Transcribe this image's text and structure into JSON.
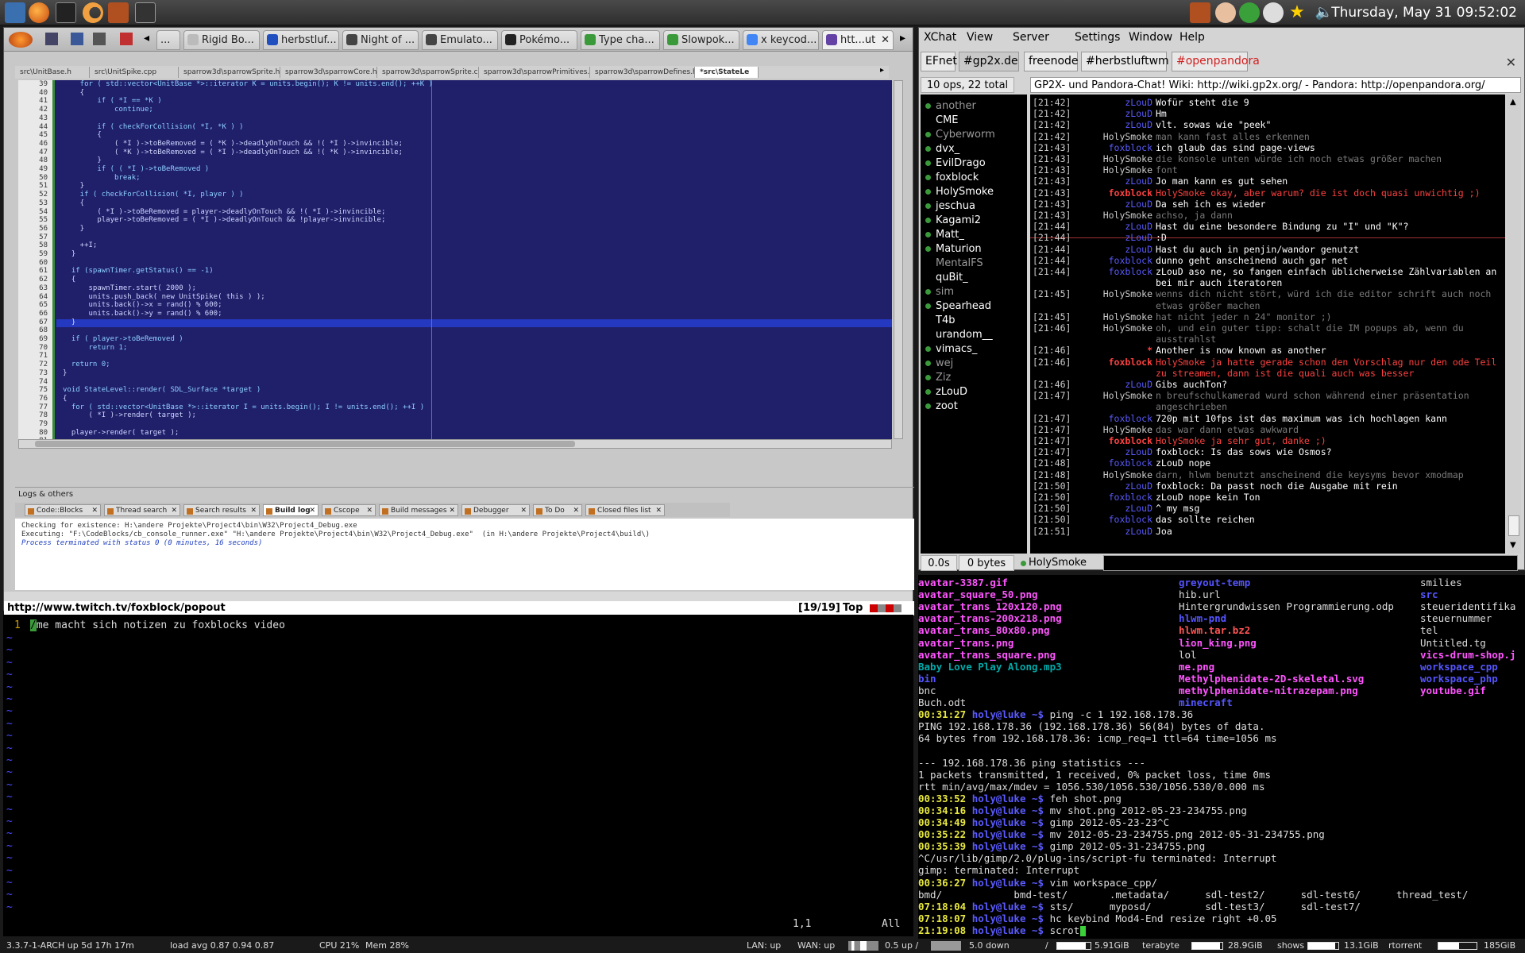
{
  "topbar": {
    "clock": "Thursday, May 31 09:52:02"
  },
  "firefox": {
    "tabs": [
      "...",
      "Rigid Bo...",
      "herbstluf...",
      "Night of ...",
      "Emulato...",
      "Pokémo...",
      "Type cha...",
      "Slowpok...",
      "x keycod...",
      "htt...ut"
    ],
    "status_url": "http://www.twitch.tv/foxblock/popout",
    "vim_pos": "[19/19]",
    "vim_top": "Top"
  },
  "codeblocks": {
    "file_tabs": [
      "src\\UnitBase.h",
      "src\\UnitSpike.cpp",
      "sparrow3d\\sparrowSprite.h",
      "sparrow3d\\sparrowCore.h",
      "sparrow3d\\sparrowSprite.c",
      "sparrow3d\\sparrowPrimitives.c",
      "sparrow3d\\sparrowDefines.h",
      "*src\\StateLe"
    ],
    "line_numbers": [
      "39",
      "40",
      "41",
      "42",
      "43",
      "44",
      "45",
      "46",
      "47",
      "48",
      "49",
      "50",
      "51",
      "52",
      "53",
      "54",
      "55",
      "56",
      "57",
      "58",
      "59",
      "60",
      "61",
      "62",
      "63",
      "64",
      "65",
      "66",
      "67",
      "68",
      "69",
      "70",
      "71",
      "72",
      "73",
      "74",
      "75",
      "76",
      "77",
      "78",
      "79",
      "80",
      "81"
    ],
    "code_lines": [
      "    for ( std::vector<UnitBase *>::iterator K = units.begin(); K != units.end(); ++K )",
      "    {",
      "        if ( *I == *K )",
      "            continue;",
      "",
      "        if ( checkForCollision( *I, *K ) )",
      "        {",
      "            ( *I )->toBeRemoved = ( *K )->deadlyOnTouch && !( *I )->invincible;",
      "            ( *K )->toBeRemoved = ( *I )->deadlyOnTouch && !( *K )->invincible;",
      "        }",
      "        if ( ( *I )->toBeRemoved )",
      "            break;",
      "    }",
      "    if ( checkForCollision( *I, player ) )",
      "    {",
      "        ( *I )->toBeRemoved = player->deadlyOnTouch && !( *I )->invincible;",
      "        player->toBeRemoved = ( *I )->deadlyOnTouch && !player->invincible;",
      "    }",
      "",
      "    ++I;",
      "  }",
      "",
      "  if (spawnTimer.getStatus() == -1)",
      "  {",
      "      spawnTimer.start( 2000 );",
      "      units.push_back( new UnitSpike( this ) );",
      "      units.back()->x = rand() % 600;",
      "      units.back()->y = rand() % 600;",
      "  }",
      "",
      "  if ( player->toBeRemoved )",
      "      return 1;",
      "",
      "  return 0;",
      "}",
      "",
      "void StateLevel::render( SDL_Surface *target )",
      "{",
      "  for ( std::vector<UnitBase *>::iterator I = units.begin(); I != units.end(); ++I )",
      "      ( *I )->render( target );",
      "",
      "  player->render( target );",
      ""
    ],
    "logs_title": "Logs & others",
    "log_tabs": [
      "Code::Blocks",
      "Thread search",
      "Search results",
      "Build log",
      "Cscope",
      "Build messages",
      "Debugger",
      "To Do",
      "Closed files list"
    ],
    "log_lines": [
      "Checking for existence: H:\\andere Projekte\\Project4\\bin\\W32\\Project4_Debug.exe",
      "Executing: \"F:\\CodeBlocks/cb_console_runner.exe\" \"H:\\andere Projekte\\Project4\\bin\\W32\\Project4_Debug.exe\"  (in H:\\andere Projekte\\Project4\\build\\)",
      "Process terminated with status 0 (0 minutes, 16 seconds)"
    ]
  },
  "vim": {
    "line_number": "1",
    "line_text": "/me macht sich notizen zu foxblocks video",
    "ruler": "1,1",
    "position": "All"
  },
  "xchat": {
    "menu": [
      "XChat",
      "View",
      "Server",
      "Settings",
      "Window",
      "Help"
    ],
    "networks": [
      "EFnet",
      "#gp2x.de",
      "freenode",
      "#herbstluftwm",
      "#openpandora"
    ],
    "ops_summary": "10 ops, 22 total",
    "topic": "GP2X- und Pandora-Chat! Wiki: http://wiki.gp2x.org/ - Pandora: http://openpandora.org/",
    "users": [
      {
        "nick": "another",
        "color": "#9a9a9a",
        "dot": "#3a9a3a"
      },
      {
        "nick": "CME",
        "color": "#ffffff",
        "dot": ""
      },
      {
        "nick": "Cyberworm",
        "color": "#9a9a9a",
        "dot": "#3a9a3a"
      },
      {
        "nick": "dvx_",
        "color": "#ffffff",
        "dot": "#3a9a3a"
      },
      {
        "nick": "EvilDrago",
        "color": "#ffffff",
        "dot": "#3a9a3a"
      },
      {
        "nick": "foxblock",
        "color": "#ffffff",
        "dot": "#3a9a3a"
      },
      {
        "nick": "HolySmoke",
        "color": "#ffffff",
        "dot": "#3a9a3a"
      },
      {
        "nick": "jeschua",
        "color": "#ffffff",
        "dot": "#3a9a3a"
      },
      {
        "nick": "Kagami2",
        "color": "#ffffff",
        "dot": "#3a9a3a"
      },
      {
        "nick": "Matt_",
        "color": "#ffffff",
        "dot": "#3a9a3a"
      },
      {
        "nick": "Maturion",
        "color": "#ffffff",
        "dot": "#3a9a3a"
      },
      {
        "nick": "MentalFS",
        "color": "#9a9a9a",
        "dot": ""
      },
      {
        "nick": "quBit_",
        "color": "#ffffff",
        "dot": ""
      },
      {
        "nick": "sim",
        "color": "#9a9a9a",
        "dot": "#3a9a3a"
      },
      {
        "nick": "Spearhead",
        "color": "#ffffff",
        "dot": "#3a9a3a"
      },
      {
        "nick": "T4b",
        "color": "#ffffff",
        "dot": ""
      },
      {
        "nick": "urandom__",
        "color": "#ffffff",
        "dot": ""
      },
      {
        "nick": "vimacs_",
        "color": "#ffffff",
        "dot": "#3a9a3a"
      },
      {
        "nick": "wej",
        "color": "#9a9a9a",
        "dot": "#3a9a3a"
      },
      {
        "nick": "Ziz",
        "color": "#9a9a9a",
        "dot": "#3a9a3a"
      },
      {
        "nick": "zLouD",
        "color": "#ffffff",
        "dot": "#3a9a3a"
      },
      {
        "nick": "zoot",
        "color": "#ffffff",
        "dot": "#3a9a3a"
      }
    ],
    "messages": [
      {
        "t": "[21:42]",
        "n": "zLouD",
        "nc": "#5a5aff",
        "m": "Wofür steht die 9",
        "mc": "#ffffff"
      },
      {
        "t": "[21:42]",
        "n": "zLouD",
        "nc": "#5a5aff",
        "m": "Hm",
        "mc": "#ffffff"
      },
      {
        "t": "[21:42]",
        "n": "zLouD",
        "nc": "#5a5aff",
        "m": "vlt. sowas wie \"peek\"",
        "mc": "#ffffff"
      },
      {
        "t": "[21:42]",
        "n": "HolySmoke",
        "nc": "#cccccc",
        "m": "man kann fast alles erkennen",
        "mc": "#7a7a7a"
      },
      {
        "t": "[21:43]",
        "n": "foxblock",
        "nc": "#5a5aff",
        "m": "ich glaub das sind page-views",
        "mc": "#ffffff"
      },
      {
        "t": "[21:43]",
        "n": "HolySmoke",
        "nc": "#cccccc",
        "m": "die konsole unten würde ich noch etwas größer machen",
        "mc": "#7a7a7a"
      },
      {
        "t": "[21:43]",
        "n": "HolySmoke",
        "nc": "#cccccc",
        "m": "font",
        "mc": "#7a7a7a"
      },
      {
        "t": "[21:43]",
        "n": "zLouD",
        "nc": "#5a5aff",
        "m": "Jo man kann es gut sehen",
        "mc": "#ffffff"
      },
      {
        "t": "[21:43]",
        "n": "foxblock",
        "nc": "#ff4040",
        "m": "HolySmoke okay, aber warum? die ist doch quasi unwichtig ;)",
        "mc": "#ff4040"
      },
      {
        "t": "[21:43]",
        "n": "zLouD",
        "nc": "#5a5aff",
        "m": "Da seh ich es wieder",
        "mc": "#ffffff"
      },
      {
        "t": "[21:43]",
        "n": "HolySmoke",
        "nc": "#cccccc",
        "m": "achso, ja dann",
        "mc": "#7a7a7a"
      },
      {
        "t": "[21:44]",
        "n": "zLouD",
        "nc": "#5a5aff",
        "m": "Hast du eine besondere Bindung zu \"I\" und \"K\"?",
        "mc": "#ffffff"
      },
      {
        "t": "[21:44]",
        "n": "zLouD",
        "nc": "#5a5aff",
        "m": ":D",
        "mc": "#ffffff"
      },
      {
        "t": "[21:44]",
        "n": "zLouD",
        "nc": "#5a5aff",
        "m": "Hast du auch in penjin/wandor genutzt",
        "mc": "#ffffff"
      },
      {
        "t": "[21:44]",
        "n": "foxblock",
        "nc": "#5a5aff",
        "m": "dunno geht anscheinend auch gar net",
        "mc": "#ffffff"
      },
      {
        "t": "[21:44]",
        "n": "foxblock",
        "nc": "#5a5aff",
        "m": "zLouD aso ne, so fangen einfach üblicherweise Zählvariablen an",
        "mc": "#ffffff"
      },
      {
        "t": "",
        "n": "",
        "nc": "#5a5aff",
        "m": "bei mir auch iteratoren",
        "mc": "#ffffff"
      },
      {
        "t": "[21:45]",
        "n": "HolySmoke",
        "nc": "#cccccc",
        "m": "wenns dich nicht stört, würd ich die editor schrift auch noch",
        "mc": "#7a7a7a"
      },
      {
        "t": "",
        "n": "",
        "nc": "#cccccc",
        "m": "etwas größer machen",
        "mc": "#7a7a7a"
      },
      {
        "t": "[21:45]",
        "n": "HolySmoke",
        "nc": "#cccccc",
        "m": "hat nicht jeder n 24\" monitor ;)",
        "mc": "#7a7a7a"
      },
      {
        "t": "[21:46]",
        "n": "HolySmoke",
        "nc": "#cccccc",
        "m": "oh, und ein guter tipp: schalt die IM popups ab, wenn du",
        "mc": "#7a7a7a"
      },
      {
        "t": "",
        "n": "",
        "nc": "#cccccc",
        "m": "ausstrahlst",
        "mc": "#7a7a7a"
      },
      {
        "t": "[21:46]",
        "n": "*",
        "nc": "#ff4040",
        "m": "Another is now known as another",
        "mc": "#ffffff"
      },
      {
        "t": "[21:46]",
        "n": "foxblock",
        "nc": "#ff4040",
        "m": "HolySmoke ja hatte gerade schon den Vorschlag nur den ode Teil",
        "mc": "#ff4040"
      },
      {
        "t": "",
        "n": "",
        "nc": "#ff4040",
        "m": "zu streamen, dann ist die quali auch was besser",
        "mc": "#ff4040"
      },
      {
        "t": "[21:46]",
        "n": "zLouD",
        "nc": "#5a5aff",
        "m": "Gibs auchTon?",
        "mc": "#ffffff"
      },
      {
        "t": "[21:47]",
        "n": "HolySmoke",
        "nc": "#cccccc",
        "m": "n breufschulkamerad wurd schon während einer präsentation",
        "mc": "#7a7a7a"
      },
      {
        "t": "",
        "n": "",
        "nc": "#cccccc",
        "m": "angeschrieben",
        "mc": "#7a7a7a"
      },
      {
        "t": "[21:47]",
        "n": "foxblock",
        "nc": "#5a5aff",
        "m": "720p mit 10fps ist das maximum was ich hochlagen kann",
        "mc": "#ffffff"
      },
      {
        "t": "[21:47]",
        "n": "HolySmoke",
        "nc": "#cccccc",
        "m": "das war dann etwas awkward",
        "mc": "#7a7a7a"
      },
      {
        "t": "[21:47]",
        "n": "foxblock",
        "nc": "#ff4040",
        "m": "HolySmoke ja sehr gut, danke ;)",
        "mc": "#ff4040"
      },
      {
        "t": "[21:47]",
        "n": "zLouD",
        "nc": "#5a5aff",
        "m": "foxblock: Is das sows wie Osmos?",
        "mc": "#ffffff"
      },
      {
        "t": "[21:48]",
        "n": "foxblock",
        "nc": "#5a5aff",
        "m": "zLouD nope",
        "mc": "#ffffff"
      },
      {
        "t": "[21:48]",
        "n": "HolySmoke",
        "nc": "#cccccc",
        "m": "darn, hlwm benutzt anscheinend die keysyms bevor xmodmap",
        "mc": "#7a7a7a"
      },
      {
        "t": "[21:50]",
        "n": "zLouD",
        "nc": "#5a5aff",
        "m": "foxblock: Da passt noch die Ausgabe mit rein",
        "mc": "#ffffff"
      },
      {
        "t": "[21:50]",
        "n": "foxblock",
        "nc": "#5a5aff",
        "m": "zLouD nope kein Ton",
        "mc": "#ffffff"
      },
      {
        "t": "[21:50]",
        "n": "zLouD",
        "nc": "#5a5aff",
        "m": "^ my msg",
        "mc": "#ffffff"
      },
      {
        "t": "[21:50]",
        "n": "foxblock",
        "nc": "#5a5aff",
        "m": "das sollte reichen",
        "mc": "#ffffff"
      },
      {
        "t": "[21:51]",
        "n": "zLouD",
        "nc": "#5a5aff",
        "m": "Joa",
        "mc": "#ffffff"
      }
    ],
    "lag": "0.0s",
    "bytes": "0 bytes",
    "my_nick": "HolySmoke"
  },
  "terminal": {
    "ls1_col1": [
      {
        "t": "avatar-3387.gif",
        "c": "#ff55ff"
      },
      {
        "t": "avatar_square_50.png",
        "c": "#ff55ff"
      },
      {
        "t": "avatar_trans_120x120.png",
        "c": "#ff55ff"
      },
      {
        "t": "avatar_trans-200x218.png",
        "c": "#ff55ff"
      },
      {
        "t": "avatar_trans_80x80.png",
        "c": "#ff55ff"
      },
      {
        "t": "avatar_trans.png",
        "c": "#ff55ff"
      },
      {
        "t": "avatar_trans_square.png",
        "c": "#ff55ff"
      },
      {
        "t": "Baby Love Play Along.mp3",
        "c": "#00aaaa"
      },
      {
        "t": "bin",
        "c": "#5555ff"
      },
      {
        "t": "bnc",
        "c": "#dddddd"
      },
      {
        "t": "Buch.odt",
        "c": "#dddddd"
      }
    ],
    "ls1_col2": [
      {
        "t": "greyout-temp",
        "c": "#5555ff"
      },
      {
        "t": "hib.url",
        "c": "#dddddd"
      },
      {
        "t": "Hintergrundwissen Programmierung.odp",
        "c": "#dddddd"
      },
      {
        "t": "hlwm-pnd",
        "c": "#5555ff"
      },
      {
        "t": "hlwm.tar.bz2",
        "c": "#ff5555"
      },
      {
        "t": "lion_king.png",
        "c": "#ff55ff"
      },
      {
        "t": "lol",
        "c": "#dddddd"
      },
      {
        "t": "me.png",
        "c": "#ff55ff"
      },
      {
        "t": "Methylphenidate-2D-skeletal.svg",
        "c": "#ff55ff"
      },
      {
        "t": "methylphenidate-nitrazepam.png",
        "c": "#ff55ff"
      },
      {
        "t": "minecraft",
        "c": "#5555ff"
      }
    ],
    "ls1_col3": [
      {
        "t": "smilies",
        "c": "#dddddd"
      },
      {
        "t": "src",
        "c": "#5555ff"
      },
      {
        "t": "steueridentifika",
        "c": "#dddddd"
      },
      {
        "t": "steuernummer",
        "c": "#dddddd"
      },
      {
        "t": "tel",
        "c": "#dddddd"
      },
      {
        "t": "Untitled.tg",
        "c": "#dddddd"
      },
      {
        "t": "vics-drum-shop.j",
        "c": "#ff55ff"
      },
      {
        "t": "workspace_cpp",
        "c": "#5555ff"
      },
      {
        "t": "workspace_php",
        "c": "#5555ff"
      },
      {
        "t": "youtube.gif",
        "c": "#ff55ff"
      }
    ],
    "lines": [
      {
        "time": "00:31:27",
        "prompt": "holy@luke ~$",
        "cmd": "ping -c 1 192.168.178.36"
      },
      {
        "text": "PING 192.168.178.36 (192.168.178.36) 56(84) bytes of data."
      },
      {
        "text": "64 bytes from 192.168.178.36: icmp_req=1 ttl=64 time=1056 ms"
      },
      {
        "text": ""
      },
      {
        "text": "--- 192.168.178.36 ping statistics ---"
      },
      {
        "text": "1 packets transmitted, 1 received, 0% packet loss, time 0ms"
      },
      {
        "text": "rtt min/avg/max/mdev = 1056.530/1056.530/1056.530/0.000 ms"
      },
      {
        "time": "00:33:52",
        "prompt": "holy@luke ~$",
        "cmd": "feh shot.png"
      },
      {
        "time": "00:34:16",
        "prompt": "holy@luke ~$",
        "cmd": "mv shot.png 2012-05-23-234755.png"
      },
      {
        "time": "00:34:49",
        "prompt": "holy@luke ~$",
        "cmd": "gimp 2012-05-23-23^C"
      },
      {
        "time": "00:35:22",
        "prompt": "holy@luke ~$",
        "cmd": "mv 2012-05-23-234755.png 2012-05-31-234755.png"
      },
      {
        "time": "00:35:39",
        "prompt": "holy@luke ~$",
        "cmd": "gimp 2012-05-31-234755.png"
      },
      {
        "text": "^C/usr/lib/gimp/2.0/plug-ins/script-fu terminated: Interrupt"
      },
      {
        "text": "gimp: terminated: Interrupt"
      },
      {
        "time": "00:36:27",
        "prompt": "holy@luke ~$",
        "cmd": "vim workspace_cpp/"
      },
      {
        "text": "bmd/            bmd-test/       .metadata/      sdl-test2/      sdl-test6/      thread_test/"
      },
      {
        "time": "07:18:04",
        "prompt": "holy@luke ~$",
        "cmd": "sts/      myposd/         sdl-test3/      sdl-test7/"
      },
      {
        "time": "07:18:07",
        "prompt": "holy@luke ~$",
        "cmd": "hc keybind Mod4-End resize right +0.05"
      },
      {
        "time": "21:19:08",
        "prompt": "holy@luke ~$",
        "cmd": "scrot"
      }
    ]
  },
  "statusbar": {
    "system": "3.3.7-1-ARCH up 5d 17h 17m",
    "load": "load avg 0.87 0.94 0.87",
    "cpu": "CPU 21%",
    "mem": "Mem 28%",
    "lan": "LAN: up",
    "wan": "WAN: up",
    "up": "0.5 up /",
    "down": "5.0 down",
    "root": "/",
    "root_free": "5.91GiB",
    "terabyte": "terabyte",
    "terabyte_free": "28.9GiB",
    "shows": "shows",
    "shows_free": "13.1GiB",
    "rtorrent": "rtorrent",
    "rtorrent_free": "185GiB"
  }
}
